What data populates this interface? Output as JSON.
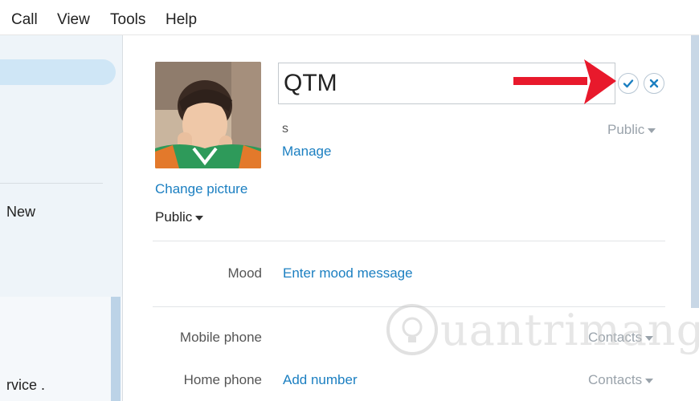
{
  "menu": [
    "Call",
    "View",
    "Tools",
    "Help"
  ],
  "left_pane": {
    "items": [
      "New",
      "rvice ."
    ]
  },
  "profile": {
    "name_value": "QTM",
    "change_picture_label": "Change picture",
    "picture_privacy": "Public",
    "small_glyph": "s",
    "manage_label": "Manage",
    "name_privacy": "Public",
    "confirm_icon": "check-icon",
    "cancel_icon": "close-icon"
  },
  "fields": {
    "mood_label": "Mood",
    "mood_link": "Enter mood message",
    "mobile_label": "Mobile phone",
    "mobile_privacy": "Contacts",
    "home_label": "Home phone",
    "home_link": "Add number",
    "home_privacy": "Contacts"
  },
  "watermark": "uantrimang",
  "colors": {
    "accent": "#1b7fc1",
    "arrow": "#e8192c"
  }
}
